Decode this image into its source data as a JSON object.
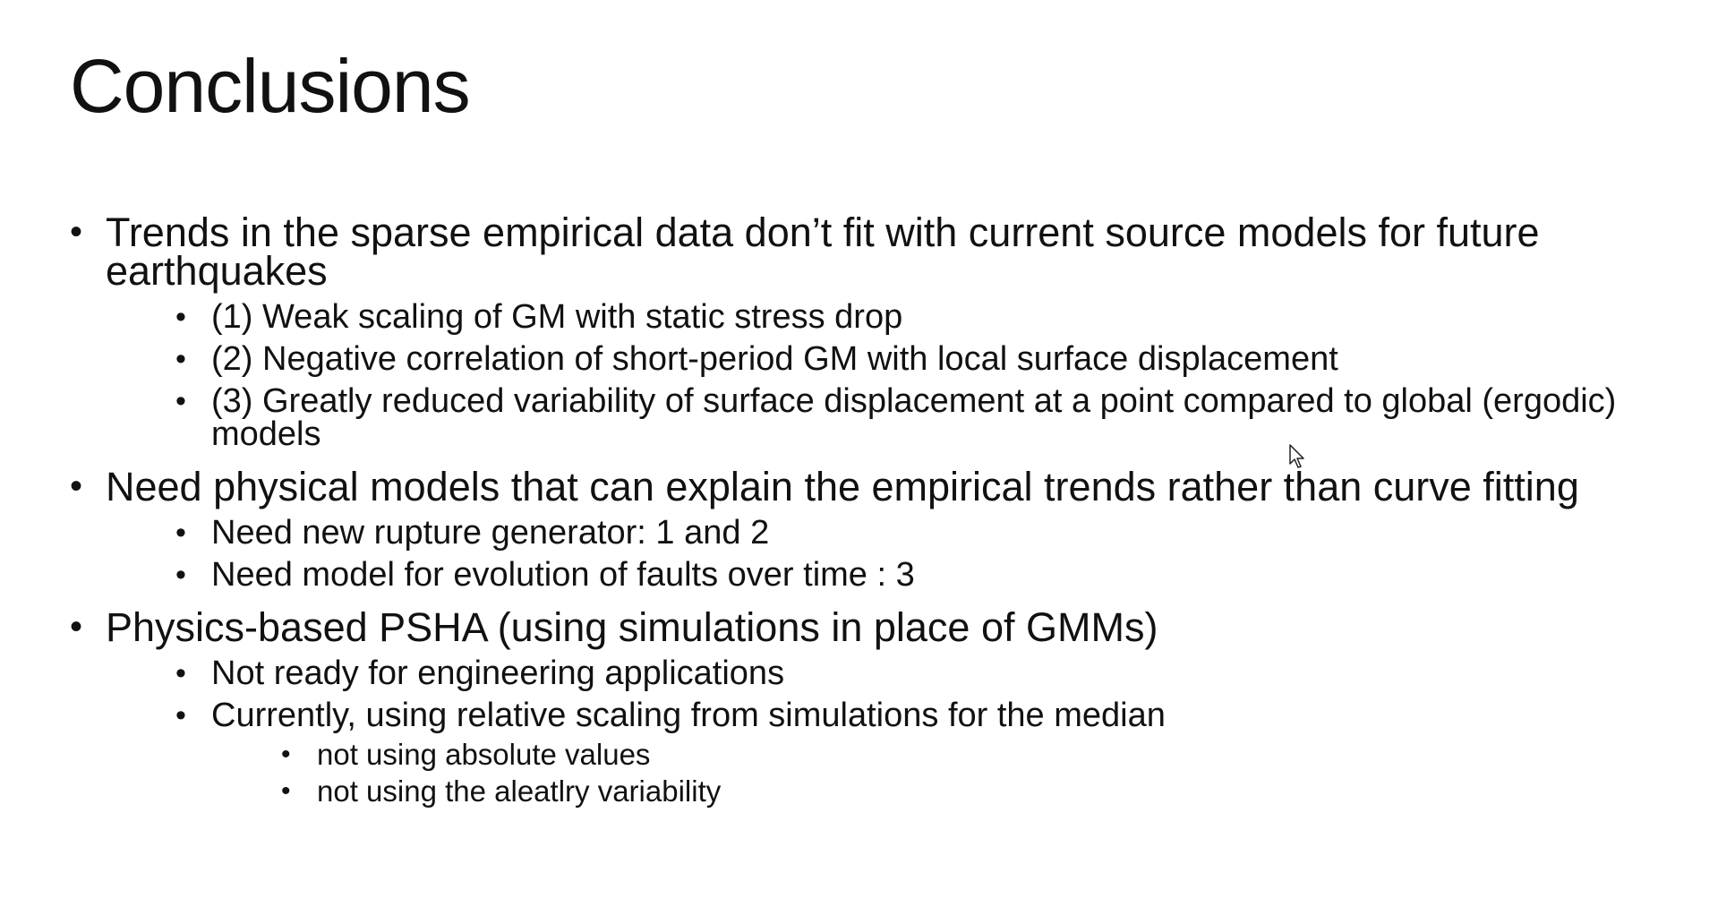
{
  "slide": {
    "title": "Conclusions",
    "bullets": [
      {
        "text": "Trends in the sparse empirical data don’t fit with current source models for future earthquakes",
        "sub": [
          "(1) Weak scaling of GM with static stress drop",
          "(2) Negative correlation of short-period GM with local surface displacement",
          "(3) Greatly reduced variability of surface displacement at a point compared to global (ergodic)  models"
        ]
      },
      {
        "text": "Need physical models that can explain the empirical trends rather than curve fitting",
        "sub": [
          "Need new rupture generator: 1 and 2",
          "Need model for evolution of faults over time : 3"
        ]
      },
      {
        "text": "Physics-based PSHA (using simulations in place of GMMs)",
        "sub": [
          "Not ready for engineering applications",
          "Currently, using relative scaling from simulations for the median"
        ],
        "subsub": [
          "not using absolute values",
          "not using the aleatlry variability"
        ]
      }
    ],
    "bullet_glyph": "•",
    "icons": {
      "cursor": "mouse-pointer-icon"
    }
  }
}
